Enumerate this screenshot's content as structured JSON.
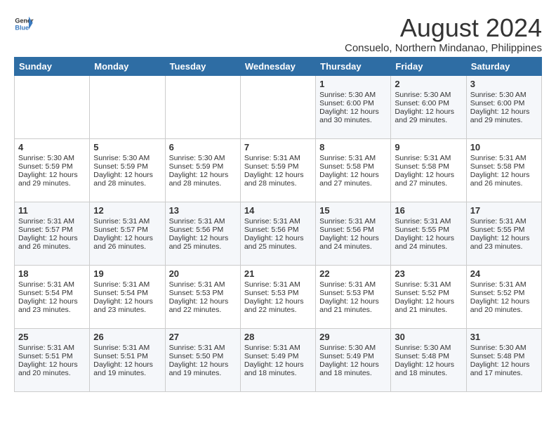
{
  "header": {
    "logo_general": "General",
    "logo_blue": "Blue",
    "month_year": "August 2024",
    "location": "Consuelo, Northern Mindanao, Philippines"
  },
  "weekdays": [
    "Sunday",
    "Monday",
    "Tuesday",
    "Wednesday",
    "Thursday",
    "Friday",
    "Saturday"
  ],
  "weeks": [
    [
      {
        "day": "",
        "sunrise": "",
        "sunset": "",
        "daylight": ""
      },
      {
        "day": "",
        "sunrise": "",
        "sunset": "",
        "daylight": ""
      },
      {
        "day": "",
        "sunrise": "",
        "sunset": "",
        "daylight": ""
      },
      {
        "day": "",
        "sunrise": "",
        "sunset": "",
        "daylight": ""
      },
      {
        "day": "1",
        "sunrise": "Sunrise: 5:30 AM",
        "sunset": "Sunset: 6:00 PM",
        "daylight": "Daylight: 12 hours and 30 minutes."
      },
      {
        "day": "2",
        "sunrise": "Sunrise: 5:30 AM",
        "sunset": "Sunset: 6:00 PM",
        "daylight": "Daylight: 12 hours and 29 minutes."
      },
      {
        "day": "3",
        "sunrise": "Sunrise: 5:30 AM",
        "sunset": "Sunset: 6:00 PM",
        "daylight": "Daylight: 12 hours and 29 minutes."
      }
    ],
    [
      {
        "day": "4",
        "sunrise": "Sunrise: 5:30 AM",
        "sunset": "Sunset: 5:59 PM",
        "daylight": "Daylight: 12 hours and 29 minutes."
      },
      {
        "day": "5",
        "sunrise": "Sunrise: 5:30 AM",
        "sunset": "Sunset: 5:59 PM",
        "daylight": "Daylight: 12 hours and 28 minutes."
      },
      {
        "day": "6",
        "sunrise": "Sunrise: 5:30 AM",
        "sunset": "Sunset: 5:59 PM",
        "daylight": "Daylight: 12 hours and 28 minutes."
      },
      {
        "day": "7",
        "sunrise": "Sunrise: 5:31 AM",
        "sunset": "Sunset: 5:59 PM",
        "daylight": "Daylight: 12 hours and 28 minutes."
      },
      {
        "day": "8",
        "sunrise": "Sunrise: 5:31 AM",
        "sunset": "Sunset: 5:58 PM",
        "daylight": "Daylight: 12 hours and 27 minutes."
      },
      {
        "day": "9",
        "sunrise": "Sunrise: 5:31 AM",
        "sunset": "Sunset: 5:58 PM",
        "daylight": "Daylight: 12 hours and 27 minutes."
      },
      {
        "day": "10",
        "sunrise": "Sunrise: 5:31 AM",
        "sunset": "Sunset: 5:58 PM",
        "daylight": "Daylight: 12 hours and 26 minutes."
      }
    ],
    [
      {
        "day": "11",
        "sunrise": "Sunrise: 5:31 AM",
        "sunset": "Sunset: 5:57 PM",
        "daylight": "Daylight: 12 hours and 26 minutes."
      },
      {
        "day": "12",
        "sunrise": "Sunrise: 5:31 AM",
        "sunset": "Sunset: 5:57 PM",
        "daylight": "Daylight: 12 hours and 26 minutes."
      },
      {
        "day": "13",
        "sunrise": "Sunrise: 5:31 AM",
        "sunset": "Sunset: 5:56 PM",
        "daylight": "Daylight: 12 hours and 25 minutes."
      },
      {
        "day": "14",
        "sunrise": "Sunrise: 5:31 AM",
        "sunset": "Sunset: 5:56 PM",
        "daylight": "Daylight: 12 hours and 25 minutes."
      },
      {
        "day": "15",
        "sunrise": "Sunrise: 5:31 AM",
        "sunset": "Sunset: 5:56 PM",
        "daylight": "Daylight: 12 hours and 24 minutes."
      },
      {
        "day": "16",
        "sunrise": "Sunrise: 5:31 AM",
        "sunset": "Sunset: 5:55 PM",
        "daylight": "Daylight: 12 hours and 24 minutes."
      },
      {
        "day": "17",
        "sunrise": "Sunrise: 5:31 AM",
        "sunset": "Sunset: 5:55 PM",
        "daylight": "Daylight: 12 hours and 23 minutes."
      }
    ],
    [
      {
        "day": "18",
        "sunrise": "Sunrise: 5:31 AM",
        "sunset": "Sunset: 5:54 PM",
        "daylight": "Daylight: 12 hours and 23 minutes."
      },
      {
        "day": "19",
        "sunrise": "Sunrise: 5:31 AM",
        "sunset": "Sunset: 5:54 PM",
        "daylight": "Daylight: 12 hours and 23 minutes."
      },
      {
        "day": "20",
        "sunrise": "Sunrise: 5:31 AM",
        "sunset": "Sunset: 5:53 PM",
        "daylight": "Daylight: 12 hours and 22 minutes."
      },
      {
        "day": "21",
        "sunrise": "Sunrise: 5:31 AM",
        "sunset": "Sunset: 5:53 PM",
        "daylight": "Daylight: 12 hours and 22 minutes."
      },
      {
        "day": "22",
        "sunrise": "Sunrise: 5:31 AM",
        "sunset": "Sunset: 5:53 PM",
        "daylight": "Daylight: 12 hours and 21 minutes."
      },
      {
        "day": "23",
        "sunrise": "Sunrise: 5:31 AM",
        "sunset": "Sunset: 5:52 PM",
        "daylight": "Daylight: 12 hours and 21 minutes."
      },
      {
        "day": "24",
        "sunrise": "Sunrise: 5:31 AM",
        "sunset": "Sunset: 5:52 PM",
        "daylight": "Daylight: 12 hours and 20 minutes."
      }
    ],
    [
      {
        "day": "25",
        "sunrise": "Sunrise: 5:31 AM",
        "sunset": "Sunset: 5:51 PM",
        "daylight": "Daylight: 12 hours and 20 minutes."
      },
      {
        "day": "26",
        "sunrise": "Sunrise: 5:31 AM",
        "sunset": "Sunset: 5:51 PM",
        "daylight": "Daylight: 12 hours and 19 minutes."
      },
      {
        "day": "27",
        "sunrise": "Sunrise: 5:31 AM",
        "sunset": "Sunset: 5:50 PM",
        "daylight": "Daylight: 12 hours and 19 minutes."
      },
      {
        "day": "28",
        "sunrise": "Sunrise: 5:31 AM",
        "sunset": "Sunset: 5:49 PM",
        "daylight": "Daylight: 12 hours and 18 minutes."
      },
      {
        "day": "29",
        "sunrise": "Sunrise: 5:30 AM",
        "sunset": "Sunset: 5:49 PM",
        "daylight": "Daylight: 12 hours and 18 minutes."
      },
      {
        "day": "30",
        "sunrise": "Sunrise: 5:30 AM",
        "sunset": "Sunset: 5:48 PM",
        "daylight": "Daylight: 12 hours and 18 minutes."
      },
      {
        "day": "31",
        "sunrise": "Sunrise: 5:30 AM",
        "sunset": "Sunset: 5:48 PM",
        "daylight": "Daylight: 12 hours and 17 minutes."
      }
    ]
  ]
}
